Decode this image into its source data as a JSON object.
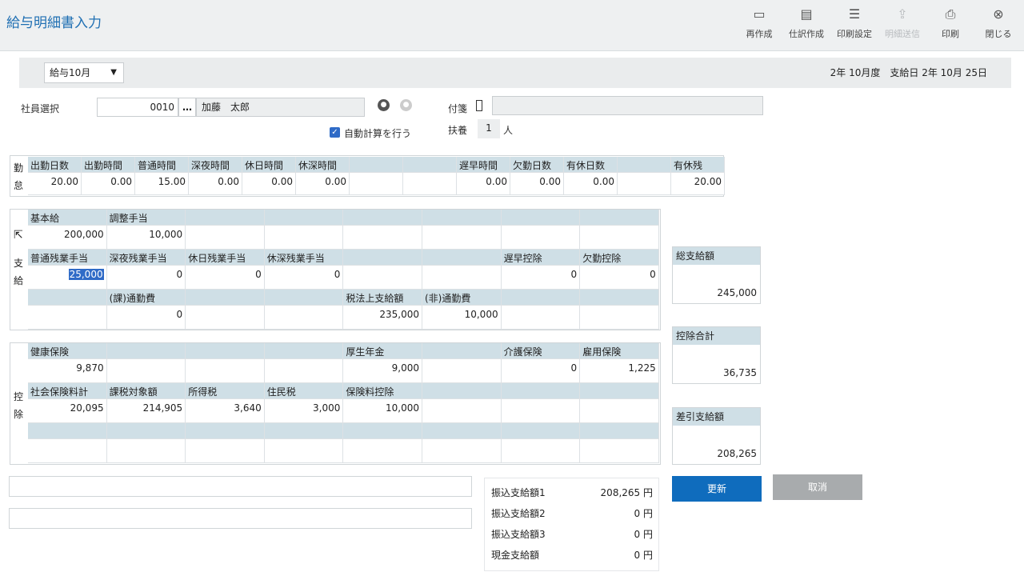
{
  "window": {
    "title": "給与明細書入力"
  },
  "toolbar": [
    {
      "name": "recreate",
      "icon": "▭",
      "label": "再作成",
      "enabled": true
    },
    {
      "name": "journal",
      "icon": "▤",
      "label": "仕訳作成",
      "enabled": true
    },
    {
      "name": "print-settings",
      "icon": "☰",
      "label": "印刷設定",
      "enabled": true
    },
    {
      "name": "send",
      "icon": "⇪",
      "label": "明細送信",
      "enabled": false
    },
    {
      "name": "print",
      "icon": "⎙",
      "label": "印刷",
      "enabled": true
    },
    {
      "name": "close",
      "icon": "⊗",
      "label": "閉じる",
      "enabled": true
    }
  ],
  "period": {
    "month": "給与10月",
    "info": "2年 10月度　支給日 2年 10月 25日"
  },
  "employee": {
    "label": "社員選択",
    "code": "0010",
    "dots": "…",
    "name": "加藤　太郎",
    "auto_calc": "自動計算を行う",
    "fusen_label": "付箋",
    "fuyo_label": "扶養",
    "fuyo_count": "1",
    "fuyo_unit": "人"
  },
  "attendance": {
    "side_label": "勤怠",
    "cells": [
      {
        "h": "出勤日数",
        "v": "20.00"
      },
      {
        "h": "出勤時間",
        "v": "0.00"
      },
      {
        "h": "普通時間",
        "v": "15.00"
      },
      {
        "h": "深夜時間",
        "v": "0.00"
      },
      {
        "h": "休日時間",
        "v": "0.00"
      },
      {
        "h": "休深時間",
        "v": "0.00"
      },
      {
        "h": "",
        "v": ""
      },
      {
        "h": "",
        "v": ""
      },
      {
        "h": "遅早時間",
        "v": "0.00"
      },
      {
        "h": "欠勤日数",
        "v": "0.00"
      },
      {
        "h": "有休日数",
        "v": "0.00"
      },
      {
        "h": "",
        "v": ""
      },
      {
        "h": "有休残",
        "v": "20.00"
      }
    ]
  },
  "payment": {
    "side_label": "支給",
    "rows": [
      [
        {
          "h": "基本給",
          "v": "200,000"
        },
        {
          "h": "調整手当",
          "v": "10,000"
        },
        {
          "h": "",
          "v": ""
        },
        {
          "h": "",
          "v": ""
        },
        {
          "h": "",
          "v": ""
        },
        {
          "h": "",
          "v": ""
        },
        {
          "h": "",
          "v": ""
        },
        {
          "h": "",
          "v": ""
        }
      ],
      [
        {
          "h": "普通残業手当",
          "v": "25,000"
        },
        {
          "h": "深夜残業手当",
          "v": "0"
        },
        {
          "h": "休日残業手当",
          "v": "0"
        },
        {
          "h": "休深残業手当",
          "v": "0"
        },
        {
          "h": "",
          "v": ""
        },
        {
          "h": "",
          "v": ""
        },
        {
          "h": "遅早控除",
          "v": "0"
        },
        {
          "h": "欠勤控除",
          "v": "0"
        }
      ],
      [
        {
          "h": "",
          "v": ""
        },
        {
          "h": "(課)通勤費",
          "v": "0"
        },
        {
          "h": "",
          "v": ""
        },
        {
          "h": "",
          "v": ""
        },
        {
          "h": "税法上支給額",
          "v": "235,000"
        },
        {
          "h": "(非)通勤費",
          "v": "10,000"
        },
        {
          "h": "",
          "v": ""
        },
        {
          "h": "",
          "v": ""
        }
      ]
    ]
  },
  "deduction": {
    "side_label": "控除",
    "rows": [
      [
        {
          "h": "健康保険",
          "v": "9,870"
        },
        {
          "h": "",
          "v": ""
        },
        {
          "h": "",
          "v": ""
        },
        {
          "h": "",
          "v": ""
        },
        {
          "h": "厚生年金",
          "v": "9,000"
        },
        {
          "h": "",
          "v": ""
        },
        {
          "h": "介護保険",
          "v": "0"
        },
        {
          "h": "雇用保険",
          "v": "1,225"
        }
      ],
      [
        {
          "h": "社会保険料計",
          "v": "20,095"
        },
        {
          "h": "課税対象額",
          "v": "214,905"
        },
        {
          "h": "所得税",
          "v": "3,640"
        },
        {
          "h": "住民税",
          "v": "3,000"
        },
        {
          "h": "保険料控除",
          "v": "10,000"
        },
        {
          "h": "",
          "v": ""
        },
        {
          "h": "",
          "v": ""
        },
        {
          "h": "",
          "v": ""
        }
      ],
      [
        {
          "h": "",
          "v": ""
        },
        {
          "h": "",
          "v": ""
        },
        {
          "h": "",
          "v": ""
        },
        {
          "h": "",
          "v": ""
        },
        {
          "h": "",
          "v": ""
        },
        {
          "h": "",
          "v": ""
        },
        {
          "h": "",
          "v": ""
        },
        {
          "h": "",
          "v": ""
        }
      ]
    ]
  },
  "summary": {
    "gross": {
      "label": "総支給額",
      "value": "245,000"
    },
    "deduction_total": {
      "label": "控除合計",
      "value": "36,735"
    },
    "net": {
      "label": "差引支給額",
      "value": "208,265"
    }
  },
  "transfer": [
    {
      "label": "振込支給額1",
      "value": "208,265 円"
    },
    {
      "label": "振込支給額2",
      "value": "0 円"
    },
    {
      "label": "振込支給額3",
      "value": "0 円"
    },
    {
      "label": "現金支給額",
      "value": "0 円"
    }
  ],
  "buttons": {
    "update": "更新",
    "cancel": "取消"
  },
  "colors": {
    "title": "#1f6fb3",
    "header": "#cfdfe6",
    "primary": "#0f6cbd",
    "disabled": "#a8abad"
  }
}
